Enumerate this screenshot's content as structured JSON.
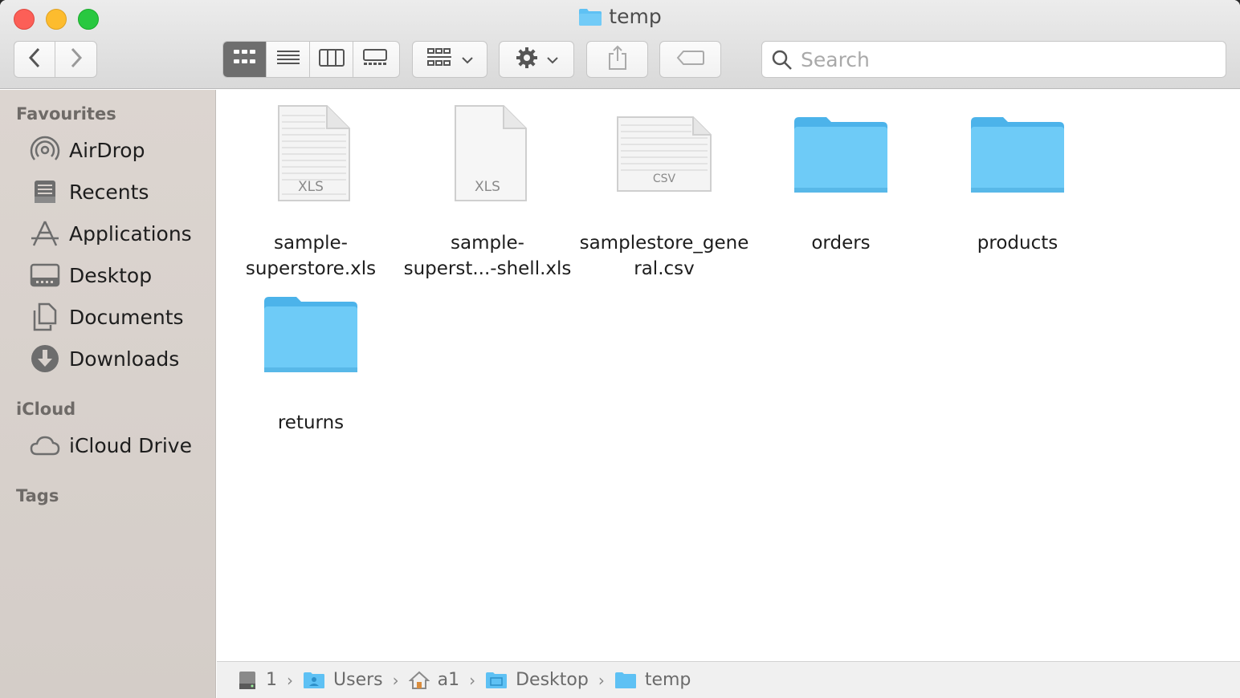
{
  "window": {
    "title": "temp"
  },
  "toolbar": {
    "back_icon": "chevron-left-icon",
    "forward_icon": "chevron-right-icon",
    "view_modes": [
      "icon-view",
      "list-view",
      "column-view",
      "gallery-view"
    ],
    "active_view": "icon-view",
    "search_placeholder": "Search"
  },
  "sidebar": {
    "sections": [
      {
        "title": "Favourites",
        "items": [
          {
            "label": "AirDrop",
            "icon": "airdrop-icon"
          },
          {
            "label": "Recents",
            "icon": "recents-icon"
          },
          {
            "label": "Applications",
            "icon": "applications-icon"
          },
          {
            "label": "Desktop",
            "icon": "desktop-icon"
          },
          {
            "label": "Documents",
            "icon": "documents-icon"
          },
          {
            "label": "Downloads",
            "icon": "downloads-icon"
          }
        ]
      },
      {
        "title": "iCloud",
        "items": [
          {
            "label": "iCloud Drive",
            "icon": "icloud-icon"
          }
        ]
      },
      {
        "title": "Tags",
        "items": []
      }
    ]
  },
  "files": [
    {
      "name_line1": "sample-",
      "name_line2": "superstore.xls",
      "type": "XLS"
    },
    {
      "name_line1": "sample-",
      "name_line2": "superst...-shell.xls",
      "type": "XLS"
    },
    {
      "name_line1": "samplestore_gene",
      "name_line2": "ral.csv",
      "type": "CSV"
    },
    {
      "name_line1": "orders",
      "name_line2": "",
      "type": "folder"
    },
    {
      "name_line1": "products",
      "name_line2": "",
      "type": "folder"
    },
    {
      "name_line1": "returns",
      "name_line2": "",
      "type": "folder"
    }
  ],
  "path": [
    "1",
    "Users",
    "a1",
    "Desktop",
    "temp"
  ],
  "colors": {
    "folder": "#5ec1f4",
    "sidebar_bg": "#d8d1cc",
    "active_view": "#6e6e6e"
  }
}
